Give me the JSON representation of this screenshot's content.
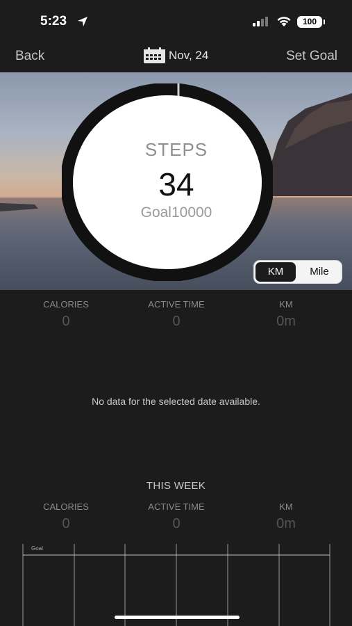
{
  "status": {
    "time": "5:23",
    "battery": "100"
  },
  "nav": {
    "back": "Back",
    "date": "Nov, 24",
    "set_goal": "Set Goal"
  },
  "hero": {
    "steps_label": "STEPS",
    "steps_value": "34",
    "goal_text": "Goal10000",
    "progress_fraction": 0.0034
  },
  "unit_toggle": {
    "km": "KM",
    "mile": "Mile",
    "selected": "KM"
  },
  "daily_stats": [
    {
      "label": "CALORIES",
      "value": "0"
    },
    {
      "label": "ACTIVE TIME",
      "value": "0"
    },
    {
      "label": "KM",
      "value": "0m"
    }
  ],
  "empty_message": "No data for the selected date available.",
  "week": {
    "title": "THIS WEEK",
    "stats": [
      {
        "label": "CALORIES",
        "value": "0"
      },
      {
        "label": "ACTIVE TIME",
        "value": "0"
      },
      {
        "label": "KM",
        "value": "0m"
      }
    ],
    "chart_goal_label": "Goal"
  },
  "colors": {
    "background": "#1c1c1d",
    "ring": "#111111",
    "accent_selected": "#1c1c1c"
  }
}
